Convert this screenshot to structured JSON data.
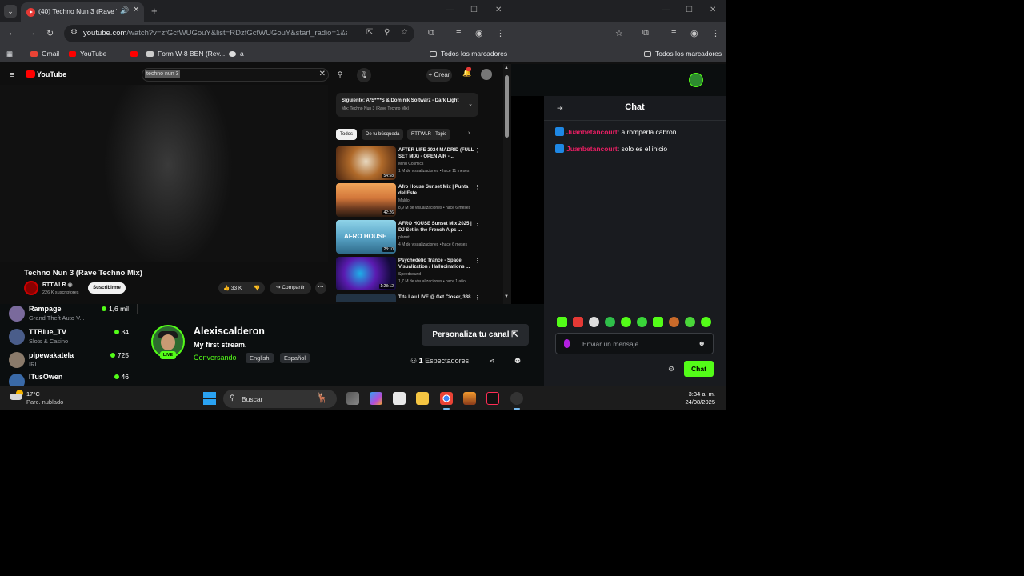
{
  "browser_left": {
    "tab_title": "(40) Techno Nun 3 (Rave Te",
    "url_main": "youtube.com",
    "url_rest": "/watch?v=zfGcfWUGouY&list=RDzfGcfWUGouY&start_radio=1&ab_...",
    "bookmarks": [
      "Gmail",
      "YouTube",
      "Form W-8 BEN (Rev...",
      "a"
    ],
    "all_bookmarks": "Todos los marcadores"
  },
  "browser_right": {
    "all_bookmarks": "Todos los marcadores"
  },
  "youtube": {
    "logo": "YouTube",
    "search_query": "techno nun 3",
    "create_label": "Crear",
    "video_title": "Techno Nun 3 (Rave Techno Mix)",
    "channel_name": "RTTWLR",
    "subscribers": "226 K suscriptores",
    "subscribe_label": "Suscribirme",
    "likes": "33 K",
    "share_label": "Compartir",
    "up_next": "Siguiente: A*S*Y*S & Dominik Soltwarz - Dark Light",
    "mix_label": "Mix: Techno Nun 3 (Rave Techno Mix)",
    "chips": [
      "Todos",
      "De tu búsqueda",
      "RTTWLR - Topic"
    ],
    "recommendations": [
      {
        "title": "AFTER LIFE 2024 MADRID (FULL SET MIX) - OPEN AIR - ...",
        "channel": "Mind Cosmics",
        "meta": "1 M de visualizaciones • hace 11 meses",
        "duration": "54:58"
      },
      {
        "title": "Afro House Sunset Mix | Punta del Este",
        "channel": "Maldo",
        "meta": "8,9 M de visualizaciones • hace 6 meses",
        "duration": "42:26"
      },
      {
        "title": "AFRO HOUSE Sunset Mix 2025 | DJ Set in the French Alps ...",
        "channel": "planet",
        "meta": "4 M de visualizaciones • hace 6 meses",
        "duration": "28:10"
      },
      {
        "title": "Psychedelic Trance - Space Visualization / Hallucinations ...",
        "channel": "Speedsound",
        "meta": "1,7 M de visualizaciones • hace 1 año",
        "duration": "1:28:12"
      },
      {
        "title": "Tita Lau LIVE @ Get Closer, 338",
        "channel": "",
        "meta": "",
        "duration": ""
      }
    ]
  },
  "kick": {
    "sidebar": [
      {
        "name": "Rampage",
        "category": "Grand Theft Auto V...",
        "viewers": "1,6 mil",
        "color": "#7a6a9c"
      },
      {
        "name": "TTBlue_TV",
        "category": "Slots & Casino",
        "viewers": "34",
        "color": "#4a5d8a"
      },
      {
        "name": "pipewakatela",
        "category": "IRL",
        "viewers": "725",
        "color": "#8a7a6a"
      },
      {
        "name": "lTusOwen",
        "category": "",
        "viewers": "46",
        "color": "#3a6aa8"
      }
    ],
    "streamer": "Alexiscalderon",
    "stream_title": "My first stream.",
    "category": "Conversando",
    "tags": [
      "English",
      "Español"
    ],
    "live_label": "LIVE",
    "customize_label": "Personaliza tu canal",
    "viewers_count": "1",
    "viewers_label": "Espectadores"
  },
  "chat": {
    "title": "Chat",
    "messages": [
      {
        "user": "Juanbetancourt",
        "text": ": a romperla cabron"
      },
      {
        "user": "Juanbetancourt",
        "text": ": solo es el inicio"
      }
    ],
    "placeholder": "Enviar un mensaje",
    "send_label": "Chat"
  },
  "taskbar": {
    "temperature": "17°C",
    "condition": "Parc. nublado",
    "search_label": "Buscar",
    "time": "3:34 a. m.",
    "date": "24/08/2025"
  },
  "colors": {
    "kick_green": "#53fc18",
    "chat_user": "#e91e63",
    "youtube_red": "#ff0000"
  }
}
